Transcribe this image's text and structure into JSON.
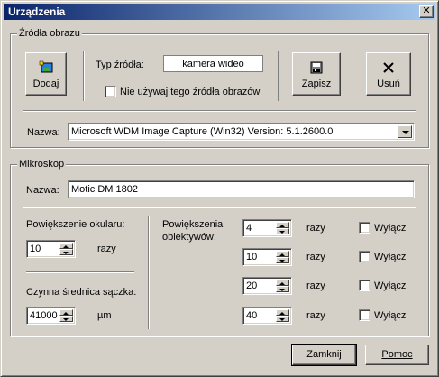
{
  "window": {
    "title": "Urządzenia"
  },
  "sources": {
    "group_title": "Źródła obrazu",
    "add_label": "Dodaj",
    "source_type_label": "Typ źródła:",
    "source_type_value": "kamera wideo",
    "dont_use_label": "Nie używaj tego źródła obrazów",
    "save_label": "Zapisz",
    "delete_label": "Usuń",
    "name_label": "Nazwa:",
    "name_value": "Microsoft WDM Image Capture (Win32) Version:  5.1.2600.0"
  },
  "microscope": {
    "group_title": "Mikroskop",
    "name_label": "Nazwa:",
    "name_value": "Motic DM 1802",
    "eyepiece_label": "Powiększenie okularu:",
    "eyepiece_value": "10",
    "eyepiece_unit": "razy",
    "aperture_label": "Czynna średnica sączka:",
    "aperture_value": "41000",
    "aperture_unit": "µm",
    "objectives_label_line1": "Powiększenia",
    "objectives_label_line2": "obiektywów:",
    "objectives": [
      {
        "value": "4",
        "unit": "razy",
        "disable_label": "Wyłącz"
      },
      {
        "value": "10",
        "unit": "razy",
        "disable_label": "Wyłącz"
      },
      {
        "value": "20",
        "unit": "razy",
        "disable_label": "Wyłącz"
      },
      {
        "value": "40",
        "unit": "razy",
        "disable_label": "Wyłącz"
      }
    ]
  },
  "footer": {
    "close_label": "Zamknij",
    "help_label": "Pomoc"
  },
  "icons": {
    "close": "close-icon",
    "add": "camera-add-icon",
    "save": "save-icon",
    "delete": "delete-x-icon"
  }
}
